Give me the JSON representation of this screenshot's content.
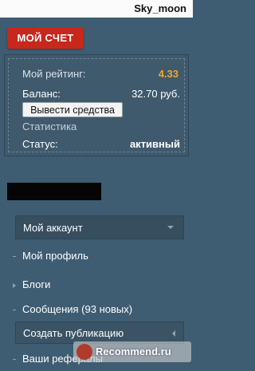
{
  "header": {
    "username": "Sky_moon"
  },
  "account": {
    "title": "МОЙ СЧЕТ"
  },
  "panel": {
    "rating_label": "Мой рейтинг:",
    "rating_value": "4.33",
    "balance_label": "Баланс:",
    "balance_value": "32.70 руб.",
    "withdraw_button": "Вывести средства",
    "stats_link": "Статистика",
    "status_label": "Статус:",
    "status_value": "активный"
  },
  "menu": {
    "account_section": "Мой аккаунт",
    "profile": "Мой профиль",
    "blogs": "Блоги",
    "messages": "Сообщения (93 новых)",
    "create_publication": "Создать публикацию",
    "referrals": "Ваши рефералы"
  },
  "watermark": {
    "text": "Recommend.ru"
  },
  "colors": {
    "badge": "#c8271b",
    "rating": "#f6a623",
    "background": "#3e5d72"
  }
}
